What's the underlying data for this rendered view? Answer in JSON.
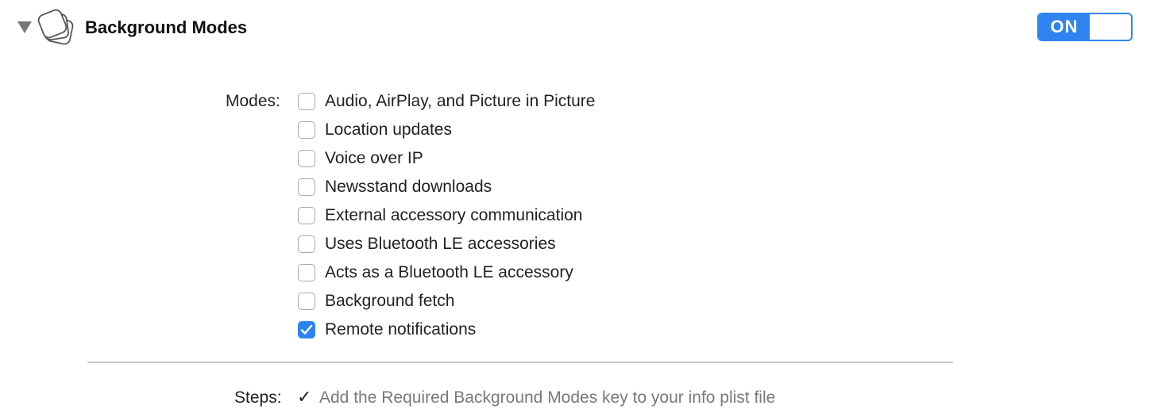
{
  "header": {
    "title": "Background Modes",
    "icon": "background-modes-icon",
    "toggle_label": "ON",
    "toggle_on": true,
    "accent_color": "#2e83f0"
  },
  "modes": {
    "label": "Modes:",
    "items": [
      {
        "label": "Audio, AirPlay, and Picture in Picture",
        "checked": false
      },
      {
        "label": "Location updates",
        "checked": false
      },
      {
        "label": "Voice over IP",
        "checked": false
      },
      {
        "label": "Newsstand downloads",
        "checked": false
      },
      {
        "label": "External accessory communication",
        "checked": false
      },
      {
        "label": "Uses Bluetooth LE accessories",
        "checked": false
      },
      {
        "label": "Acts as a Bluetooth LE accessory",
        "checked": false
      },
      {
        "label": "Background fetch",
        "checked": false
      },
      {
        "label": "Remote notifications",
        "checked": true
      }
    ]
  },
  "steps": {
    "label": "Steps:",
    "items": [
      {
        "text": "Add the Required Background Modes key to your info plist file",
        "done": true
      }
    ]
  }
}
